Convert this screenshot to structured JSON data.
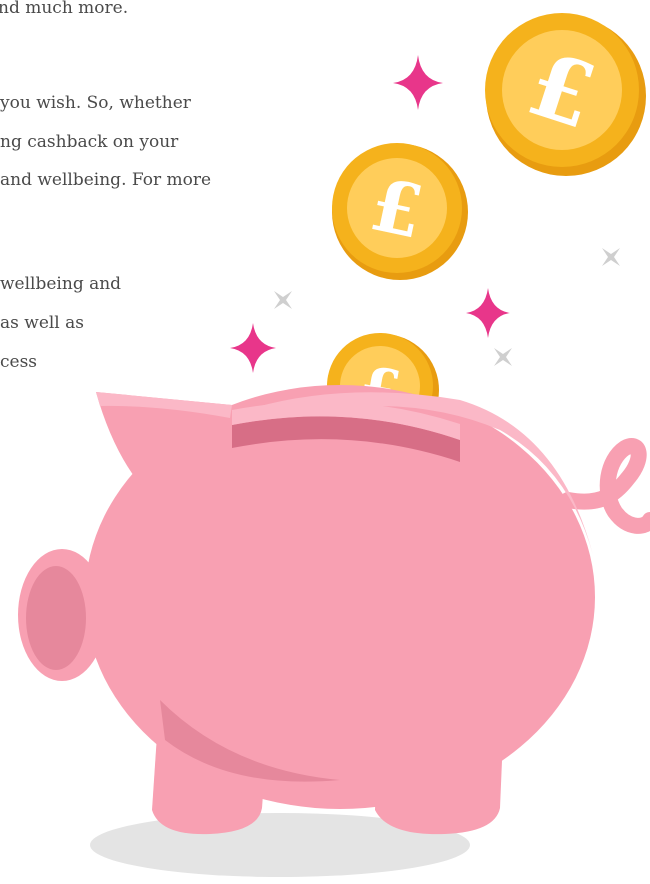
{
  "text_lines": [
    "nd much more.",
    "you wish. So, whether",
    "ng cashback on your",
    "and wellbeing. For more",
    "wellbeing and",
    "as well as",
    "cess"
  ],
  "coin_symbol": "£",
  "colors": {
    "pig_body": "#f8a0b2",
    "pig_light": "#fbb8c7",
    "pig_dark": "#e6889c",
    "coin_outer": "#f5b21c",
    "coin_inner": "#ffcd5a",
    "sparkle_pink": "#e8368a",
    "sparkle_gray": "#cfcfcf",
    "shadow": "#e4e4e4",
    "text": "#4a4a4a"
  }
}
